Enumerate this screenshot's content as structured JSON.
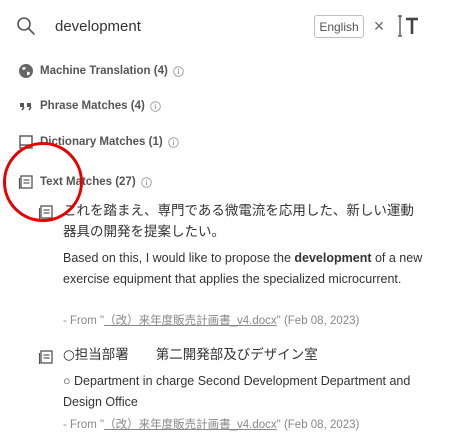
{
  "search": {
    "query": "development"
  },
  "language_button": "English",
  "sections": [
    {
      "label": "Machine Translation (4)",
      "icon": "globe-icon"
    },
    {
      "label": "Phrase Matches (4)",
      "icon": "quote-icon"
    },
    {
      "label": "Dictionary Matches (1)",
      "icon": "book-icon"
    },
    {
      "label": "Text Matches (27)",
      "icon": "document-icon"
    }
  ],
  "entries": [
    {
      "jp": "これを踏まえ、専門である微電流を応用した、新しい運動器具の開発を提案したい。",
      "en_before": "Based on this, I would like to propose the ",
      "en_highlight": "development",
      "en_after": " of a new exercise equipment that applies the specialized microcurrent.",
      "source_prefix": "- From \"",
      "source_file": "（改）来年度販売計画書_v4.docx",
      "source_suffix": "\" (Feb 08, 2023)"
    },
    {
      "jp": "○担当部署　　第二開発部及びデザイン室",
      "en": "○ Department in charge Second Development Department and Design Office",
      "source_prefix": "- From \"",
      "source_file": "（改）来年度販売計画書_v4.docx",
      "source_suffix": "\" (Feb 08, 2023)"
    }
  ]
}
